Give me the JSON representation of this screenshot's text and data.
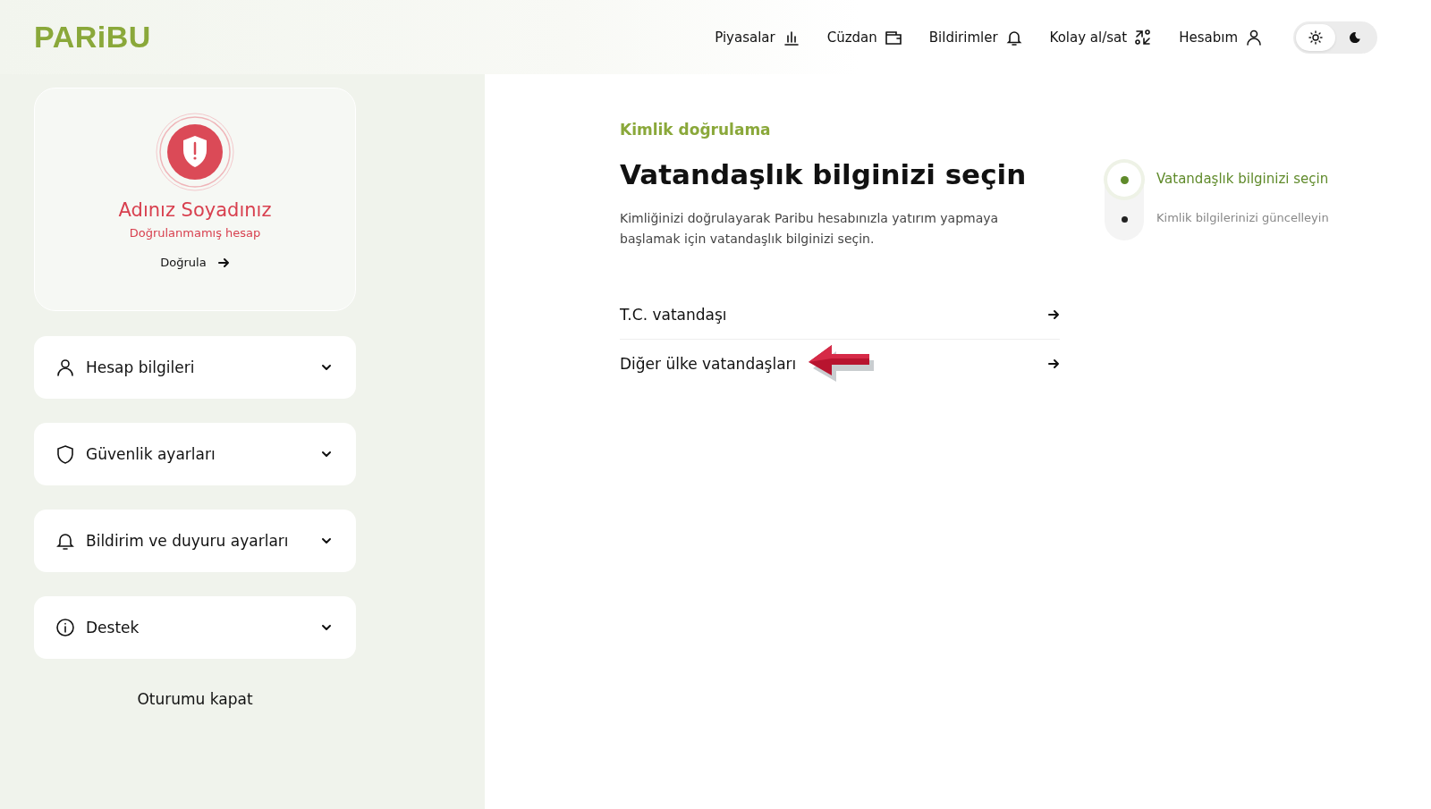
{
  "logo": "PARiBU",
  "nav": [
    {
      "label": "Piyasalar",
      "kind": "chart"
    },
    {
      "label": "Cüzdan",
      "kind": "wallet"
    },
    {
      "label": "Bildirimler",
      "kind": "bell"
    },
    {
      "label": "Kolay al/sat",
      "kind": "swap"
    },
    {
      "label": "Hesabım",
      "kind": "user"
    }
  ],
  "theme_toggle": [
    {
      "kind": "sun",
      "selected": true
    },
    {
      "kind": "moon",
      "selected": false
    }
  ],
  "profile": {
    "name": "Adınız Soyadınız",
    "status": "Doğrulanmamış hesap",
    "verify_link": "Doğrula"
  },
  "menu": [
    {
      "label": "Hesap bilgileri",
      "kind": "user",
      "expanded": false
    },
    {
      "label": "Güvenlik ayarları",
      "kind": "shield",
      "expanded": false
    },
    {
      "label": "Bildirim ve duyuru ayarları",
      "kind": "bell",
      "expanded": false
    },
    {
      "label": "Destek",
      "kind": "info",
      "expanded": false
    }
  ],
  "logout": "Oturumu kapat",
  "section_label": "Kimlik doğrulama",
  "title": "Vatandaşlık bilginizi seçin",
  "description": "Kimliğinizi doğrulayarak Paribu hesabınızla yatırım yapmaya başlamak için vatandaşlık bilginizi seçin.",
  "options": [
    {
      "label": "T.C. vatandaşı",
      "annotated": false
    },
    {
      "label": "Diğer ülke vatandaşları",
      "annotated": true
    }
  ],
  "steps": [
    {
      "label": "Vatandaşlık bilginizi seçin",
      "selected": true
    },
    {
      "label": "Kimlik bilgilerinizi güncelleyin",
      "selected": false
    }
  ]
}
